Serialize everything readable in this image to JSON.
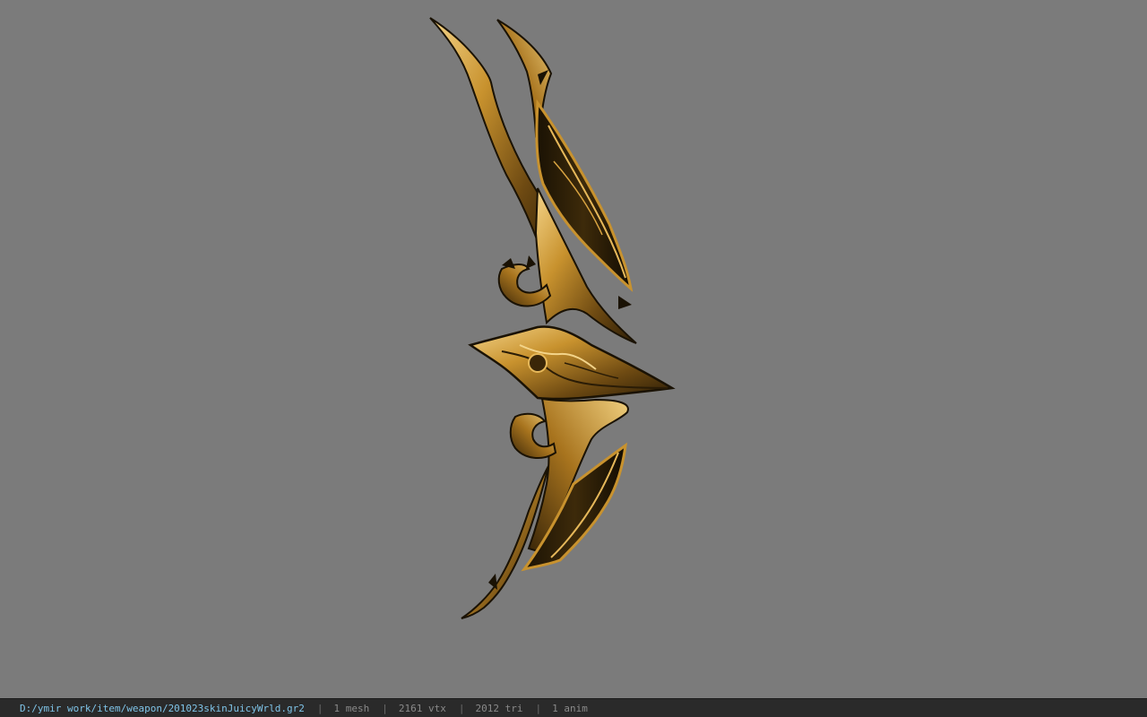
{
  "viewport": {
    "background": "#7b7b7b",
    "model_name": "weapon-bow-model"
  },
  "statusbar": {
    "path": "D:/ymir work/item/weapon/201023skinJuicyWrld.gr2",
    "separator": "|",
    "mesh": "1 mesh",
    "vtx": "2161 vtx",
    "tri": "2012 tri",
    "anim": "1 anim",
    "path_color": "#7fc4e8"
  }
}
